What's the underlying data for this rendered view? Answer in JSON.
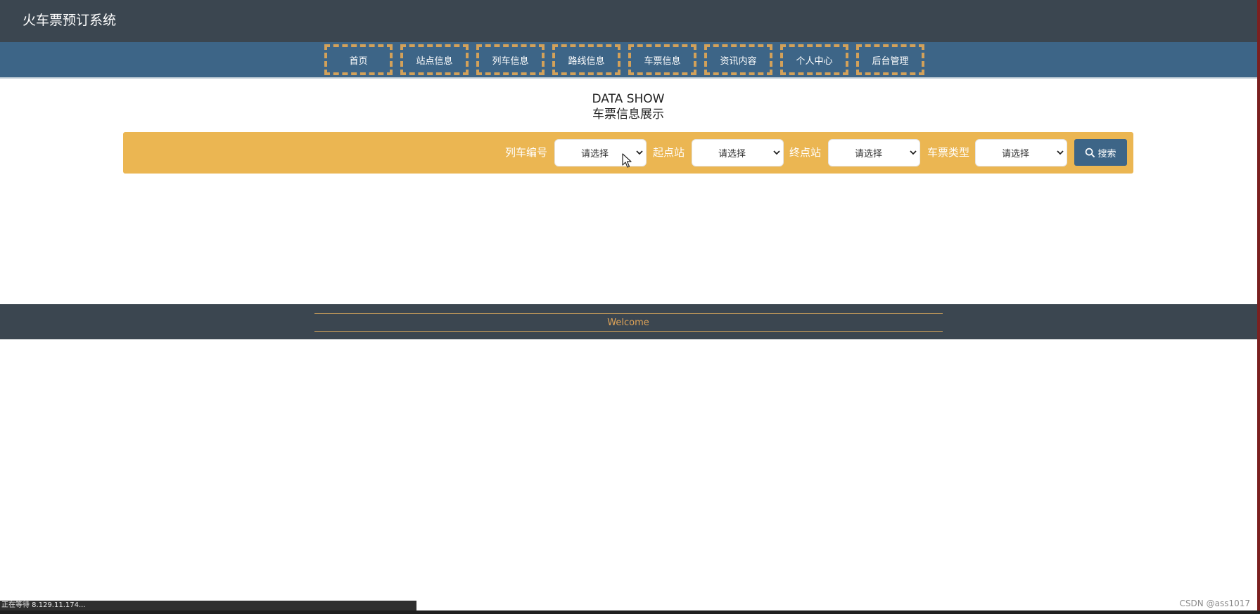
{
  "header": {
    "site_title": "火车票预订系统"
  },
  "nav": {
    "items": [
      {
        "label": "首页"
      },
      {
        "label": "站点信息"
      },
      {
        "label": "列车信息"
      },
      {
        "label": "路线信息"
      },
      {
        "label": "车票信息"
      },
      {
        "label": "资讯内容"
      },
      {
        "label": "个人中心"
      },
      {
        "label": "后台管理"
      }
    ]
  },
  "main": {
    "heading_en": "DATA SHOW",
    "heading_cn": "车票信息展示"
  },
  "search": {
    "filters": [
      {
        "label": "列车编号",
        "selected": "请选择"
      },
      {
        "label": "起点站",
        "selected": "请选择"
      },
      {
        "label": "终点站",
        "selected": "请选择"
      },
      {
        "label": "车票类型",
        "selected": "请选择"
      }
    ],
    "button_label": "搜索"
  },
  "footer": {
    "text": "Welcome"
  },
  "browser": {
    "status_text": "正在等待 8.129.11.174...",
    "watermark": "CSDN @ass1017"
  },
  "icons": {
    "search_button_icon": "search-icon",
    "select_arrow_icon": "chevron-down-icon",
    "cursor_icon": "mouse-pointer-icon"
  },
  "colors": {
    "header_bg": "#3b4650",
    "nav_bg": "#3d6587",
    "nav_border": "#d2a15a",
    "search_bar_bg": "#ebb652",
    "button_bg": "#3d6587",
    "footer_text": "#e0a458"
  }
}
